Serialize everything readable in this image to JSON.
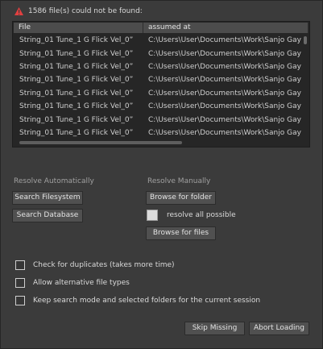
{
  "warning": {
    "icon": "warning-icon",
    "text": "1586 file(s) could not be found:",
    "color": "#e04040"
  },
  "table": {
    "headers": [
      "File",
      "assumed at"
    ],
    "rows": [
      {
        "file": "String_01 Tune_1 G Flick Vel_0”",
        "path": "C:\\Users\\User\\Documents\\Work\\Sanjo Gay"
      },
      {
        "file": "String_01 Tune_1 G Flick Vel_0”",
        "path": "C:\\Users\\User\\Documents\\Work\\Sanjo Gay"
      },
      {
        "file": "String_01 Tune_1 G Flick Vel_0”",
        "path": "C:\\Users\\User\\Documents\\Work\\Sanjo Gay"
      },
      {
        "file": "String_01 Tune_1 G Flick Vel_0”",
        "path": "C:\\Users\\User\\Documents\\Work\\Sanjo Gay"
      },
      {
        "file": "String_01 Tune_1 G Flick Vel_0”",
        "path": "C:\\Users\\User\\Documents\\Work\\Sanjo Gay"
      },
      {
        "file": "String_01 Tune_1 G Flick Vel_0”",
        "path": "C:\\Users\\User\\Documents\\Work\\Sanjo Gay"
      },
      {
        "file": "String_01 Tune_1 G Flick Vel_0”",
        "path": "C:\\Users\\User\\Documents\\Work\\Sanjo Gay"
      },
      {
        "file": "String_01 Tune_1 G Flick Vel_0”",
        "path": "C:\\Users\\User\\Documents\\Work\\Sanjo Gay"
      }
    ]
  },
  "resolve_auto": {
    "heading": "Resolve Automatically",
    "search_filesystem": "Search Filesystem",
    "search_database": "Search Database"
  },
  "resolve_manual": {
    "heading": "Resolve Manually",
    "browse_folder": "Browse for folder",
    "resolve_all": "resolve all possible",
    "browse_files": "Browse for files"
  },
  "options": {
    "check_duplicates": "Check for duplicates (takes more time)",
    "alt_types": "Allow alternative file types",
    "keep_mode": "Keep search mode and selected folders for the current session"
  },
  "footer": {
    "skip": "Skip Missing",
    "abort": "Abort Loading"
  }
}
